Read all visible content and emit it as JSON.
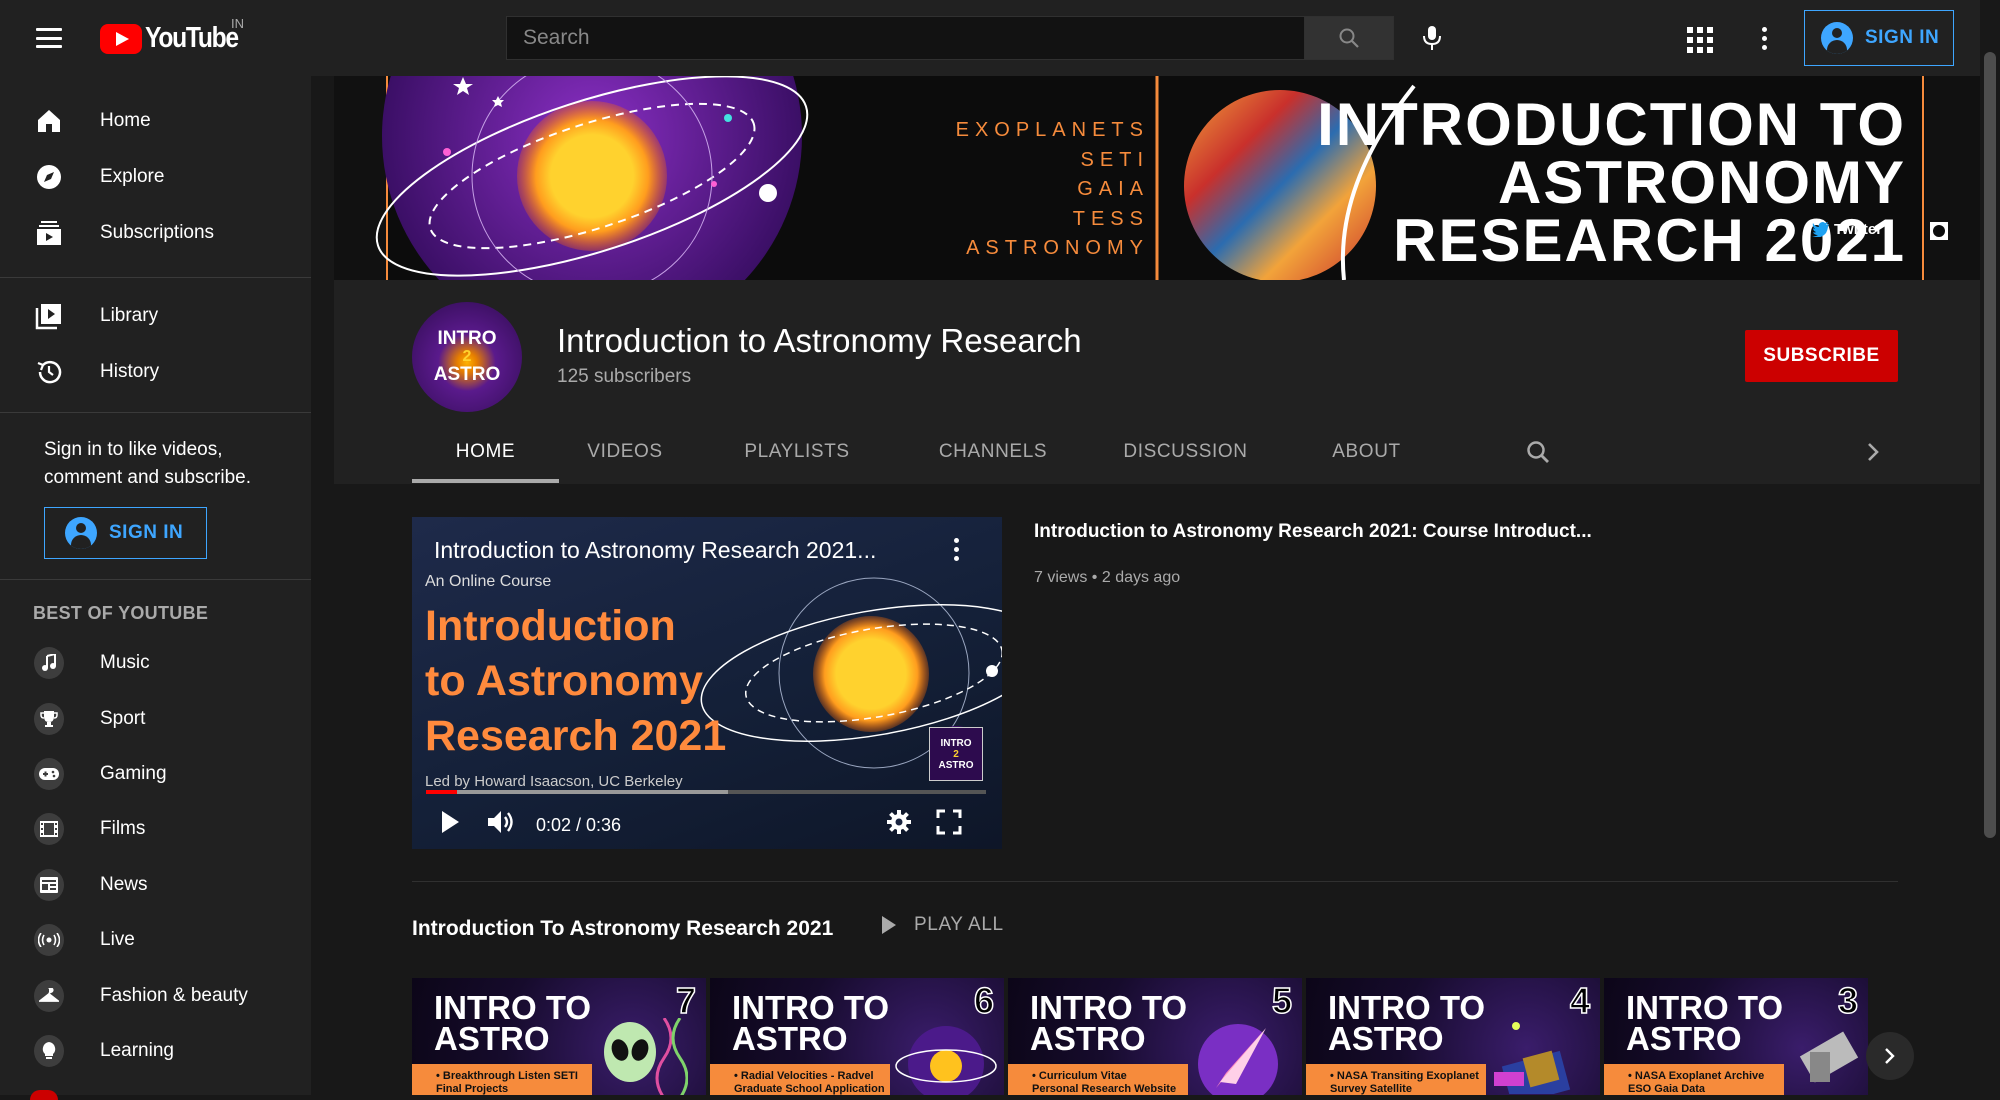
{
  "header": {
    "logo_text": "YouTube",
    "country_code": "IN",
    "search_placeholder": "Search",
    "sign_in_label": "SIGN IN"
  },
  "sidebar": {
    "primary": [
      {
        "label": "Home",
        "icon": "home-icon"
      },
      {
        "label": "Explore",
        "icon": "compass-icon"
      },
      {
        "label": "Subscriptions",
        "icon": "subscriptions-icon"
      }
    ],
    "secondary": [
      {
        "label": "Library",
        "icon": "library-icon"
      },
      {
        "label": "History",
        "icon": "history-icon"
      }
    ],
    "signin_prompt": "Sign in to like videos, comment and subscribe.",
    "sign_in_label": "SIGN IN",
    "best_heading": "BEST OF YOUTUBE",
    "best": [
      {
        "label": "Music",
        "icon": "music-icon"
      },
      {
        "label": "Sport",
        "icon": "trophy-icon"
      },
      {
        "label": "Gaming",
        "icon": "gamepad-icon"
      },
      {
        "label": "Films",
        "icon": "film-icon"
      },
      {
        "label": "News",
        "icon": "news-icon"
      },
      {
        "label": "Live",
        "icon": "live-icon"
      },
      {
        "label": "Fashion & beauty",
        "icon": "hanger-icon"
      },
      {
        "label": "Learning",
        "icon": "lightbulb-icon"
      }
    ]
  },
  "banner": {
    "topics": [
      "EXOPLANETS",
      "SETI",
      "GAIA",
      "TESS",
      "ASTRONOMY"
    ],
    "headline": [
      "INTRODUCTION TO",
      "ASTRONOMY",
      "RESEARCH 2021"
    ],
    "link_twitter": "Twitter"
  },
  "channel": {
    "avatar_text": [
      "INTRO",
      "2",
      "ASTRO"
    ],
    "title": "Introduction to Astronomy Research",
    "subscribers": "125 subscribers",
    "subscribe_label": "SUBSCRIBE",
    "tabs": [
      "HOME",
      "VIDEOS",
      "PLAYLISTS",
      "CHANNELS",
      "DISCUSSION",
      "ABOUT"
    ]
  },
  "featured": {
    "player_title": "Introduction to Astronomy Research 2021...",
    "thumb_subtitle": "An Online Course",
    "thumb_heading": [
      "Introduction",
      "to Astronomy",
      "Research 2021"
    ],
    "thumb_credit": "Led by Howard Isaacson, UC Berkeley",
    "badge_text": [
      "INTRO",
      "2",
      "ASTRO"
    ],
    "time": "0:02 / 0:36",
    "progress_played": 0.056,
    "progress_buffered": 0.54,
    "title": "Introduction to Astronomy Research 2021: Course Introduct...",
    "meta": "7 views • 2 days ago"
  },
  "shelf": {
    "title": "Introduction To Astronomy Research 2021",
    "play_all": "PLAY ALL",
    "items": [
      {
        "number": "7",
        "heading": [
          "INTRO TO",
          "ASTRO"
        ],
        "caption": "• Breakthrough Listen SETI\nFinal Projects"
      },
      {
        "number": "6",
        "heading": [
          "INTRO TO",
          "ASTRO"
        ],
        "caption": "• Radial Velocities - Radvel\nGraduate School Application"
      },
      {
        "number": "5",
        "heading": [
          "INTRO TO",
          "ASTRO"
        ],
        "caption": "• Curriculum Vitae\nPersonal Research Website"
      },
      {
        "number": "4",
        "heading": [
          "INTRO TO",
          "ASTRO"
        ],
        "caption": "• NASA Transiting Exoplanet\nSurvey Satellite"
      },
      {
        "number": "3",
        "heading": [
          "INTRO TO",
          "ASTRO"
        ],
        "caption": "• NASA Exoplanet Archive\nESO Gaia Data"
      }
    ]
  },
  "colors": {
    "accent_blue": "#3ea6ff",
    "subscribe_red": "#cc0000",
    "banner_orange": "#f68b3c"
  }
}
